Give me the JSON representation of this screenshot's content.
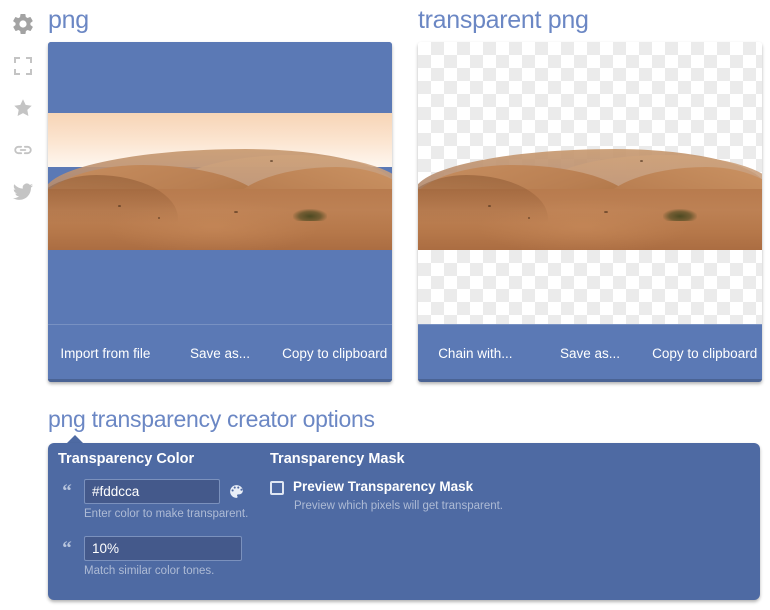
{
  "sidebar": {
    "items": [
      {
        "icon": "gear-icon",
        "name": "settings"
      },
      {
        "icon": "fullscreen-icon",
        "name": "fullscreen"
      },
      {
        "icon": "star-icon",
        "name": "favorite"
      },
      {
        "icon": "link-icon",
        "name": "permalink"
      },
      {
        "icon": "twitter-icon",
        "name": "twitter-share"
      }
    ]
  },
  "panels": {
    "left": {
      "title": "png",
      "actions": [
        "Import from file",
        "Save as...",
        "Copy to clipboard"
      ],
      "background": "#5b79b5",
      "transparent": false
    },
    "right": {
      "title": "transparent png",
      "actions": [
        "Chain with...",
        "Save as...",
        "Copy to clipboard"
      ],
      "background": "#ffffff",
      "transparent": true
    }
  },
  "options": {
    "title": "png transparency creator options",
    "color_group": {
      "heading": "Transparency Color",
      "color_value": "#fddcca",
      "color_hint": "Enter color to make transparent.",
      "tolerance_value": "10%",
      "tolerance_hint": "Match similar color tones.",
      "picker_icon": "palette-icon"
    },
    "mask_group": {
      "heading": "Transparency Mask",
      "checkbox_label": "Preview Transparency Mask",
      "checkbox_checked": false,
      "hint": "Preview which pixels will get transparent."
    }
  },
  "theme": {
    "accent": "#6b87c4",
    "panel_blue": "#5b79b5",
    "options_blue": "#4e6aa3",
    "input_blue": "#44598b",
    "hint_text": "#aebbd5"
  }
}
